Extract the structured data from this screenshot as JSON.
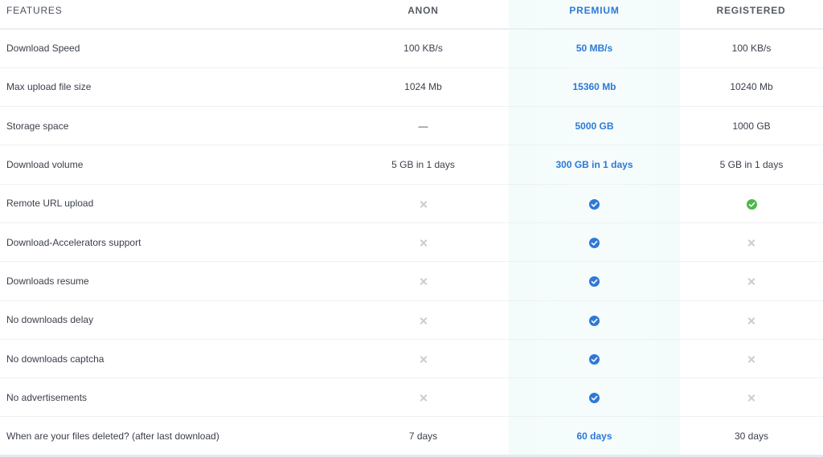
{
  "header": {
    "features": "FEATURES",
    "anon": "ANON",
    "premium": "PREMIUM",
    "registered": "REGISTERED"
  },
  "colors": {
    "premium_accent": "#2a7ad6",
    "check_blue": "#2f78d8",
    "check_green": "#4cb84a",
    "cross_gray": "#c9ccd1",
    "premium_column_bg": "#f5fbfb"
  },
  "rows": [
    {
      "feature": "Download Speed",
      "anon": "100 KB/s",
      "premium": "50 MB/s",
      "registered": "100 KB/s"
    },
    {
      "feature": "Max upload file size",
      "anon": "1024 Mb",
      "premium": "15360 Mb",
      "registered": "10240 Mb"
    },
    {
      "feature": "Storage space",
      "anon": "—",
      "premium": "5000 GB",
      "registered": "1000 GB"
    },
    {
      "feature": "Download volume",
      "anon": "5 GB in 1 days",
      "premium": "300 GB in 1 days",
      "registered": "5 GB in 1 days"
    },
    {
      "feature": "Remote URL upload",
      "anon_icon": "cross-icon",
      "premium_icon": "check-circle-blue-icon",
      "registered_icon": "check-circle-green-icon"
    },
    {
      "feature": "Download-Accelerators support",
      "anon_icon": "cross-icon",
      "premium_icon": "check-circle-blue-icon",
      "registered_icon": "cross-icon"
    },
    {
      "feature": "Downloads resume",
      "anon_icon": "cross-icon",
      "premium_icon": "check-circle-blue-icon",
      "registered_icon": "cross-icon"
    },
    {
      "feature": "No downloads delay",
      "anon_icon": "cross-icon",
      "premium_icon": "check-circle-blue-icon",
      "registered_icon": "cross-icon"
    },
    {
      "feature": "No downloads captcha",
      "anon_icon": "cross-icon",
      "premium_icon": "check-circle-blue-icon",
      "registered_icon": "cross-icon"
    },
    {
      "feature": "No advertisements",
      "anon_icon": "cross-icon",
      "premium_icon": "check-circle-blue-icon",
      "registered_icon": "cross-icon"
    },
    {
      "feature": "When are your files deleted? (after last download)",
      "anon": "7 days",
      "premium": "60 days",
      "registered": "30 days"
    }
  ]
}
